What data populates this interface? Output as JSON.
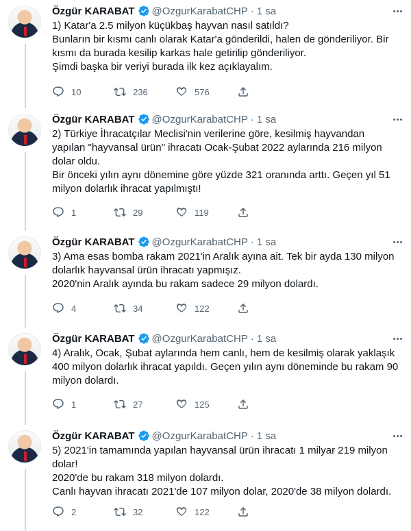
{
  "colors": {
    "text": "#0f1419",
    "secondary": "#536471",
    "verified": "#1d9bf0",
    "thread": "#cfd9de"
  },
  "tweets": [
    {
      "name": "Özgür KARABAT",
      "handle": "@OzgurKarabatCHP",
      "time": "1 sa",
      "lines": [
        "1) Katar'a 2.5 milyon küçükbaş hayvan nasıl satıldı?",
        "Bunların bir kısmı canlı olarak Katar'a gönderildi, halen de gönderiliyor. Bir",
        "kısmı da burada kesilip karkas hale getirilip gönderiliyor.",
        "Şimdi başka bir veriyi burada ilk kez açıklayalım."
      ],
      "replies": "10",
      "retweets": "236",
      "likes": "576"
    },
    {
      "name": "Özgür KARABAT",
      "handle": "@OzgurKarabatCHP",
      "time": "1 sa",
      "lines": [
        "2) Türkiye İhracatçılar Meclisi'nin verilerine göre, kesilmiş hayvandan",
        "yapılan \"hayvansal ürün\" ihracatı Ocak-Şubat 2022 aylarında 216 milyon",
        "dolar oldu.",
        "Bir önceki yılın aynı dönemine göre yüzde 321 oranında arttı. Geçen yıl 51",
        "milyon dolarlık ihracat yapılmıştı!"
      ],
      "replies": "1",
      "retweets": "29",
      "likes": "119"
    },
    {
      "name": "Özgür KARABAT",
      "handle": "@OzgurKarabatCHP",
      "time": "1 sa",
      "lines": [
        "3) Ama esas bomba rakam 2021'in Aralık ayına ait. Tek bir ayda 130 milyon",
        "dolarlık hayvansal ürün ihracatı yapmışız.",
        "2020'nin Aralık ayında bu rakam sadece 29 milyon dolardı."
      ],
      "replies": "4",
      "retweets": "34",
      "likes": "122"
    },
    {
      "name": "Özgür KARABAT",
      "handle": "@OzgurKarabatCHP",
      "time": "1 sa",
      "lines": [
        "4) Aralık, Ocak, Şubat aylarında hem canlı, hem de kesilmiş olarak yaklaşık",
        "400 milyon dolarlık ihracat yapıldı. Geçen yılın aynı döneminde bu rakam 90",
        "milyon dolardı."
      ],
      "replies": "1",
      "retweets": "27",
      "likes": "125"
    },
    {
      "name": "Özgür KARABAT",
      "handle": "@OzgurKarabatCHP",
      "time": "1 sa",
      "lines": [
        "5) 2021'in tamamında yapılan hayvansal ürün ihracatı 1 milyar 219 milyon",
        "dolar!",
        "2020'de bu rakam 318 milyon dolardı.",
        "Canlı hayvan ihracatı 2021'de 107 milyon dolar, 2020'de 38 milyon dolardı."
      ],
      "replies": "2",
      "retweets": "32",
      "likes": "122"
    }
  ]
}
